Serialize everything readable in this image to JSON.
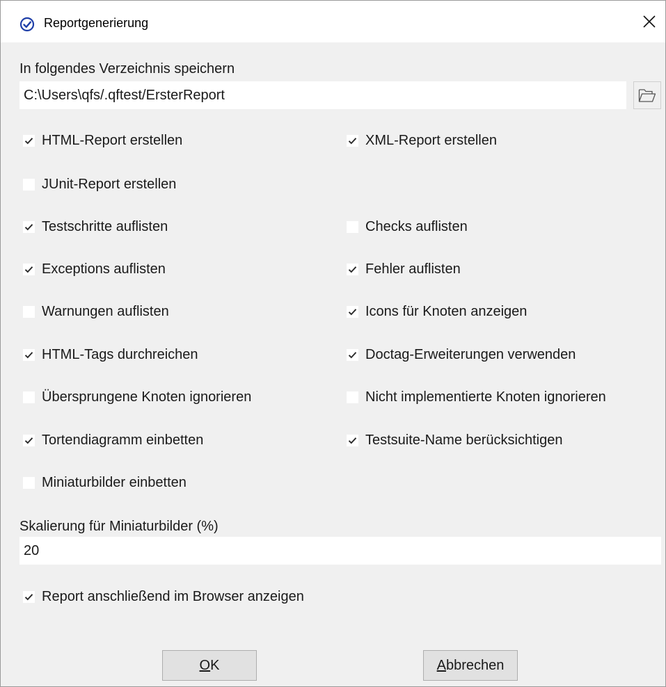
{
  "window": {
    "title": "Reportgenerierung",
    "app_icon": "checkmark-circle-icon",
    "close_icon": "close-icon"
  },
  "directory": {
    "label": "In folgendes Verzeichnis speichern",
    "value": "C:\\Users\\qfs/.qftest/ErsterReport",
    "browse_icon": "folder-open-icon"
  },
  "options": [
    {
      "label": "HTML-Report erstellen",
      "checked": true
    },
    {
      "label": "XML-Report erstellen",
      "checked": true
    },
    {
      "label": "JUnit-Report erstellen",
      "checked": false
    },
    {
      "label": "Testschritte auflisten",
      "checked": true
    },
    {
      "label": "Checks auflisten",
      "checked": false
    },
    {
      "label": "Exceptions auflisten",
      "checked": true
    },
    {
      "label": "Fehler auflisten",
      "checked": true
    },
    {
      "label": "Warnungen auflisten",
      "checked": false
    },
    {
      "label": "Icons für Knoten anzeigen",
      "checked": true
    },
    {
      "label": "HTML-Tags durchreichen",
      "checked": true
    },
    {
      "label": "Doctag-Erweiterungen verwenden",
      "checked": true
    },
    {
      "label": "Übersprungene Knoten ignorieren",
      "checked": false
    },
    {
      "label": "Nicht implementierte Knoten ignorieren",
      "checked": false
    },
    {
      "label": "Tortendiagramm einbetten",
      "checked": true
    },
    {
      "label": "Testsuite-Name berücksichtigen",
      "checked": true
    },
    {
      "label": "Miniaturbilder einbetten",
      "checked": false
    }
  ],
  "scaling": {
    "label": "Skalierung für Miniaturbilder (%)",
    "value": "20"
  },
  "show_in_browser": {
    "label": "Report anschließend im Browser anzeigen",
    "checked": true
  },
  "buttons": {
    "ok_mnemonic": "O",
    "ok_rest": "K",
    "cancel_mnemonic": "A",
    "cancel_rest": "bbrechen"
  },
  "colors": {
    "accent": "#1f3fa8",
    "background": "#f0f0f0",
    "field": "#ffffff"
  }
}
